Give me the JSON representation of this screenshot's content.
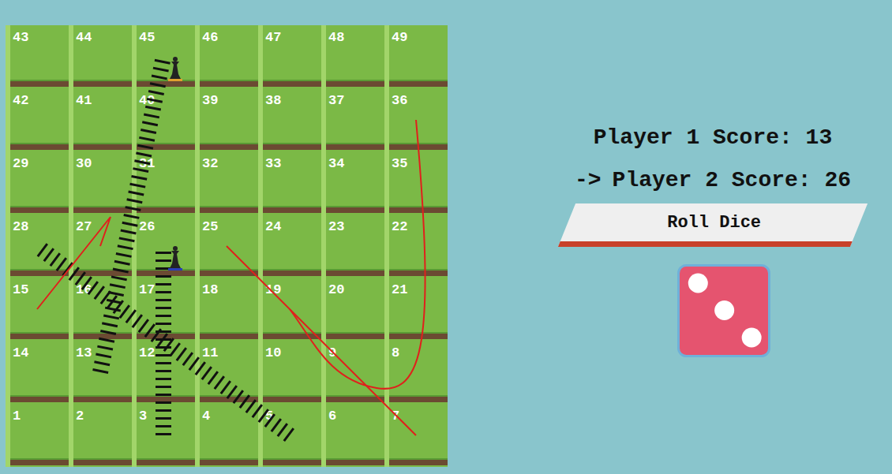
{
  "board": {
    "rows": [
      [
        "43",
        "44",
        "45",
        "46",
        "47",
        "48",
        "49"
      ],
      [
        "42",
        "41",
        "40",
        "39",
        "38",
        "37",
        "36"
      ],
      [
        "29",
        "30",
        "31",
        "32",
        "33",
        "34",
        "35"
      ],
      [
        "28",
        "27",
        "26",
        "25",
        "24",
        "23",
        "22"
      ],
      [
        "15",
        "16",
        "17",
        "18",
        "19",
        "20",
        "21"
      ],
      [
        "14",
        "13",
        "12",
        "11",
        "10",
        "9",
        "8"
      ],
      [
        "1",
        "2",
        "3",
        "4",
        "5",
        "6",
        "7"
      ]
    ]
  },
  "ladders": [
    {
      "from": 3,
      "to": 26
    },
    {
      "from": 13,
      "to": 45
    },
    {
      "from": 5,
      "to": 28
    }
  ],
  "snakes": [
    {
      "from": 36,
      "to": 19,
      "kind": "curve"
    },
    {
      "from": 25,
      "to": 7,
      "kind": "straight"
    },
    {
      "from": 27,
      "to": 15,
      "kind": "hook"
    }
  ],
  "pieces": [
    {
      "square": 45,
      "color": "#e0a030"
    },
    {
      "square": 26,
      "color": "#2a3db8"
    }
  ],
  "turn_marker": "->",
  "players": [
    {
      "label": "Player 1 Score: 13",
      "current": false
    },
    {
      "label": "Player 2 Score: 26",
      "current": true
    }
  ],
  "roll_button": {
    "label": "Roll Dice"
  },
  "dice": {
    "value": 3
  }
}
